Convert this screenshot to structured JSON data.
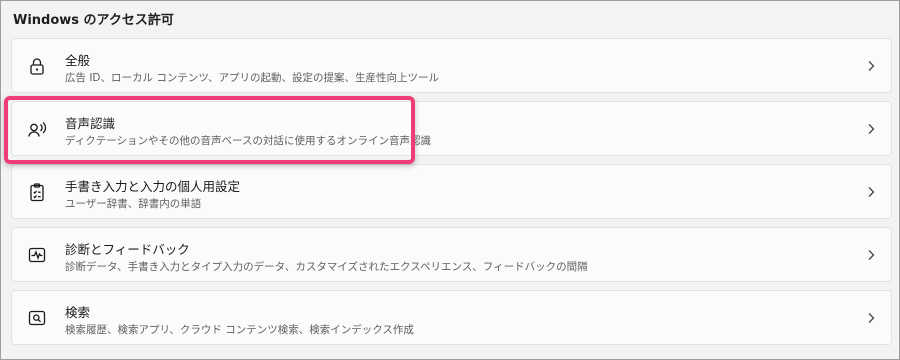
{
  "section": {
    "title": "Windows のアクセス許可"
  },
  "items": [
    {
      "icon": "lock-icon",
      "title": "全般",
      "description": "広告 ID、ローカル コンテンツ、アプリの起動、設定の提案、生産性向上ツール"
    },
    {
      "icon": "speech-person-icon",
      "title": "音声認識",
      "description": "ディクテーションやその他の音声ベースの対話に使用するオンライン音声認識"
    },
    {
      "icon": "clipboard-checklist-icon",
      "title": "手書き入力と入力の個人用設定",
      "description": "ユーザー辞書、辞書内の単語"
    },
    {
      "icon": "diagnostics-pulse-icon",
      "title": "診断とフィードバック",
      "description": "診断データ、手書き入力とタイプ入力のデータ、カスタマイズされたエクスペリエンス、フィードバックの間隔"
    },
    {
      "icon": "search-icon",
      "title": "検索",
      "description": "検索履歴、検索アプリ、クラウド コンテンツ検索、検索インデックス作成"
    }
  ],
  "highlight_color": "#ee3d74"
}
